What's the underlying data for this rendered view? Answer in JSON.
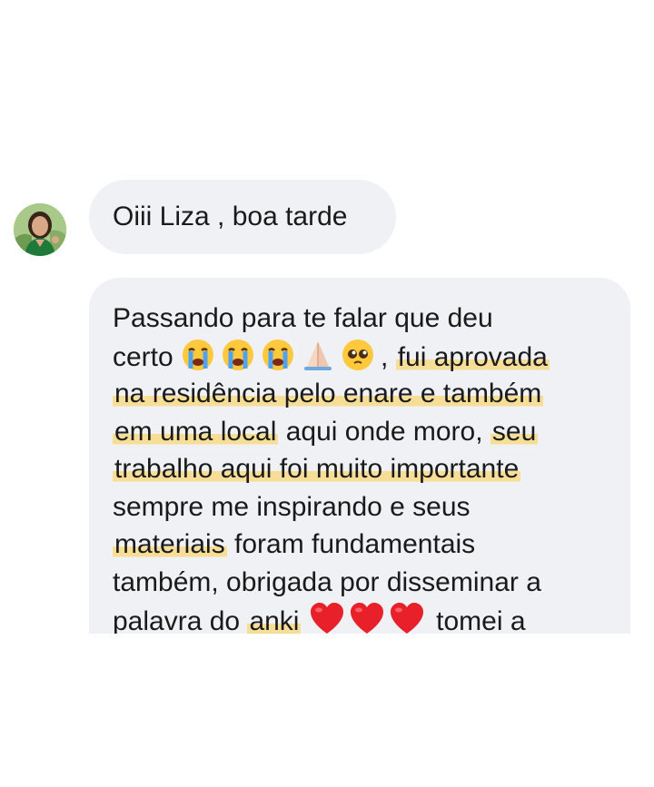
{
  "chat": {
    "contact_avatar_icon": "profile-photo",
    "messages": [
      {
        "text": "Oiii Liza , boa tarde"
      },
      {
        "lines": {
          "l1": "Passando para te falar que deu",
          "l2_a": "certo ",
          "l2_b": ", ",
          "l2_hl": "fui aprovada",
          "l3_hl": "na residência pelo enare e também",
          "l4_hl": "em uma local",
          "l4_b": " aqui onde moro, ",
          "l4_hl2": "seu",
          "l5_hl": "trabalho aqui foi muito importante",
          "l6": "sempre me inspirando e seus",
          "l7_hl": "materiais",
          "l7_b": " foram fundamentais",
          "l8": "também, obrigada por disseminar a",
          "l9_a": "palavra do ",
          "l9_hl": "anki",
          "l9_b": " tomei a"
        },
        "emojis": [
          "loudly-crying-face",
          "loudly-crying-face",
          "loudly-crying-face",
          "folded-hands",
          "pleading-face",
          "red-heart",
          "red-heart",
          "red-heart"
        ]
      }
    ],
    "colors": {
      "bubble": "#eff1f4",
      "highlight": "#fad778",
      "text": "#1a1a1a"
    }
  }
}
